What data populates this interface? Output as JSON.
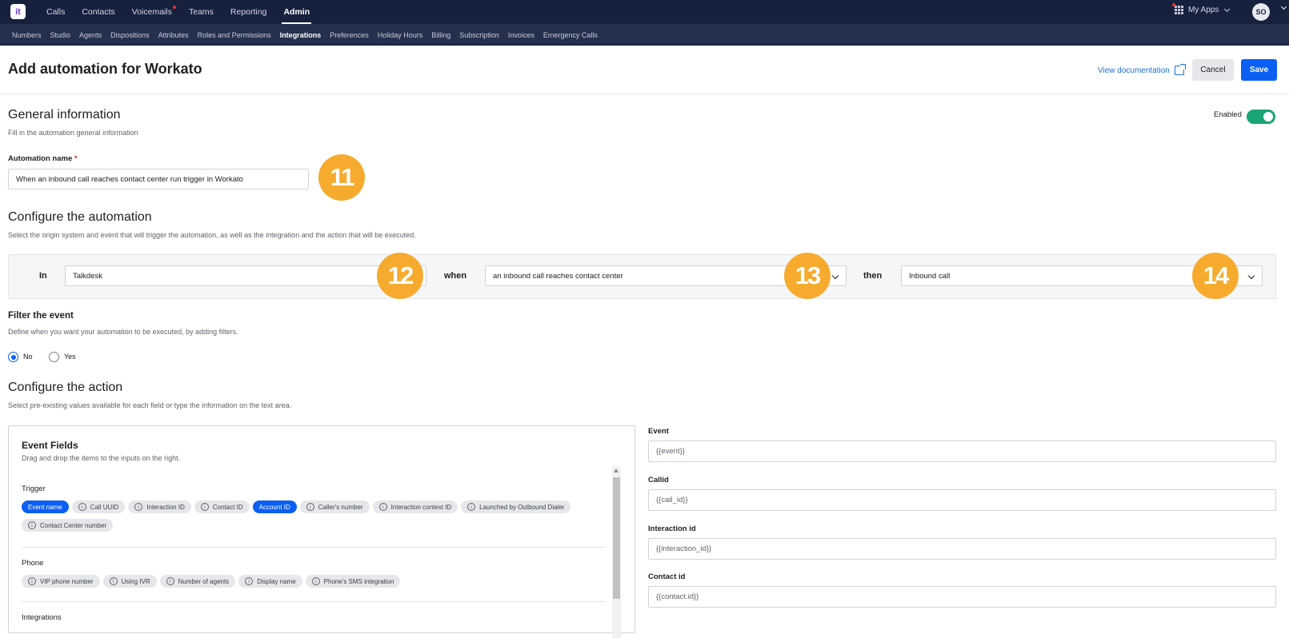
{
  "app": {
    "logo_text": "it"
  },
  "topnav": {
    "items": [
      "Calls",
      "Contacts",
      "Voicemails",
      "Teams",
      "Reporting",
      "Admin"
    ],
    "myapps_label": "My Apps",
    "avatar_initials": "SO"
  },
  "subnav": {
    "items": [
      "Numbers",
      "Studio",
      "Agents",
      "Dispositions",
      "Attributes",
      "Roles and Permissions",
      "Integrations",
      "Preferences",
      "Holiday Hours",
      "Billing",
      "Subscription",
      "Invoices",
      "Emergency Calls"
    ]
  },
  "header": {
    "title": "Add automation for Workato",
    "doc_link": "View documentation",
    "cancel_label": "Cancel",
    "save_label": "Save"
  },
  "general": {
    "title": "General information",
    "subtitle": "Fill in the automation general information",
    "enabled_label": "Enabled",
    "name_label": "Automation name",
    "required_mark": "*",
    "name_value": "When an inbound call reaches contact center run trigger in Workato"
  },
  "configure": {
    "title": "Configure the automation",
    "subtitle": "Select the origin system and event that will trigger the automation, as well as the integration and the action that will be executed.",
    "in_label": "In",
    "in_value": "Talkdesk",
    "when_label": "when",
    "when_value": "an inbound call reaches contact center",
    "then_label": "then",
    "then_value": "Inbound call"
  },
  "filter": {
    "title": "Filter the event",
    "subtitle": "Define when you want your automation to be executed, by adding filters.",
    "option_no": "No",
    "option_yes": "Yes"
  },
  "action": {
    "title": "Configure the action",
    "subtitle": "Select pre-existing values available for each field or type the information on the text area."
  },
  "event_fields": {
    "title": "Event Fields",
    "subtitle": "Drag and drop the items to the inputs on the right.",
    "groups": [
      {
        "label": "Trigger",
        "chips": [
          {
            "label": "Event name",
            "info": false,
            "active": true
          },
          {
            "label": "Call UUID",
            "info": true,
            "active": false
          },
          {
            "label": "Interaction ID",
            "info": true,
            "active": false
          },
          {
            "label": "Contact ID",
            "info": true,
            "active": false
          },
          {
            "label": "Account ID",
            "info": false,
            "active": true
          },
          {
            "label": "Caller's number",
            "info": true,
            "active": false
          },
          {
            "label": "Interaction context ID",
            "info": true,
            "active": false
          },
          {
            "label": "Launched by Outbound Dialer",
            "info": true,
            "active": false
          },
          {
            "label": "Contact Center number",
            "info": true,
            "active": false
          }
        ]
      },
      {
        "label": "Phone",
        "chips": [
          {
            "label": "VIP phone number",
            "info": true,
            "active": false
          },
          {
            "label": "Using IVR",
            "info": true,
            "active": false
          },
          {
            "label": "Number of agents",
            "info": true,
            "active": false
          },
          {
            "label": "Display name",
            "info": true,
            "active": false
          },
          {
            "label": "Phone's SMS integration",
            "info": true,
            "active": false
          }
        ]
      },
      {
        "label": "Integrations",
        "chips": []
      }
    ]
  },
  "right_fields": [
    {
      "label": "Event",
      "value": "{{event}}"
    },
    {
      "label": "Callid",
      "value": "{{call_id}}"
    },
    {
      "label": "Interaction id",
      "value": "{{interaction_id}}"
    },
    {
      "label": "Contact id",
      "value": "{{contact.id}}"
    }
  ],
  "badges": [
    "11",
    "12",
    "13",
    "14"
  ],
  "colors": {
    "topbar": "#16213e",
    "accent": "#0b5ff2",
    "toggle_on": "#1aa574",
    "badge": "#f6ab2f"
  }
}
